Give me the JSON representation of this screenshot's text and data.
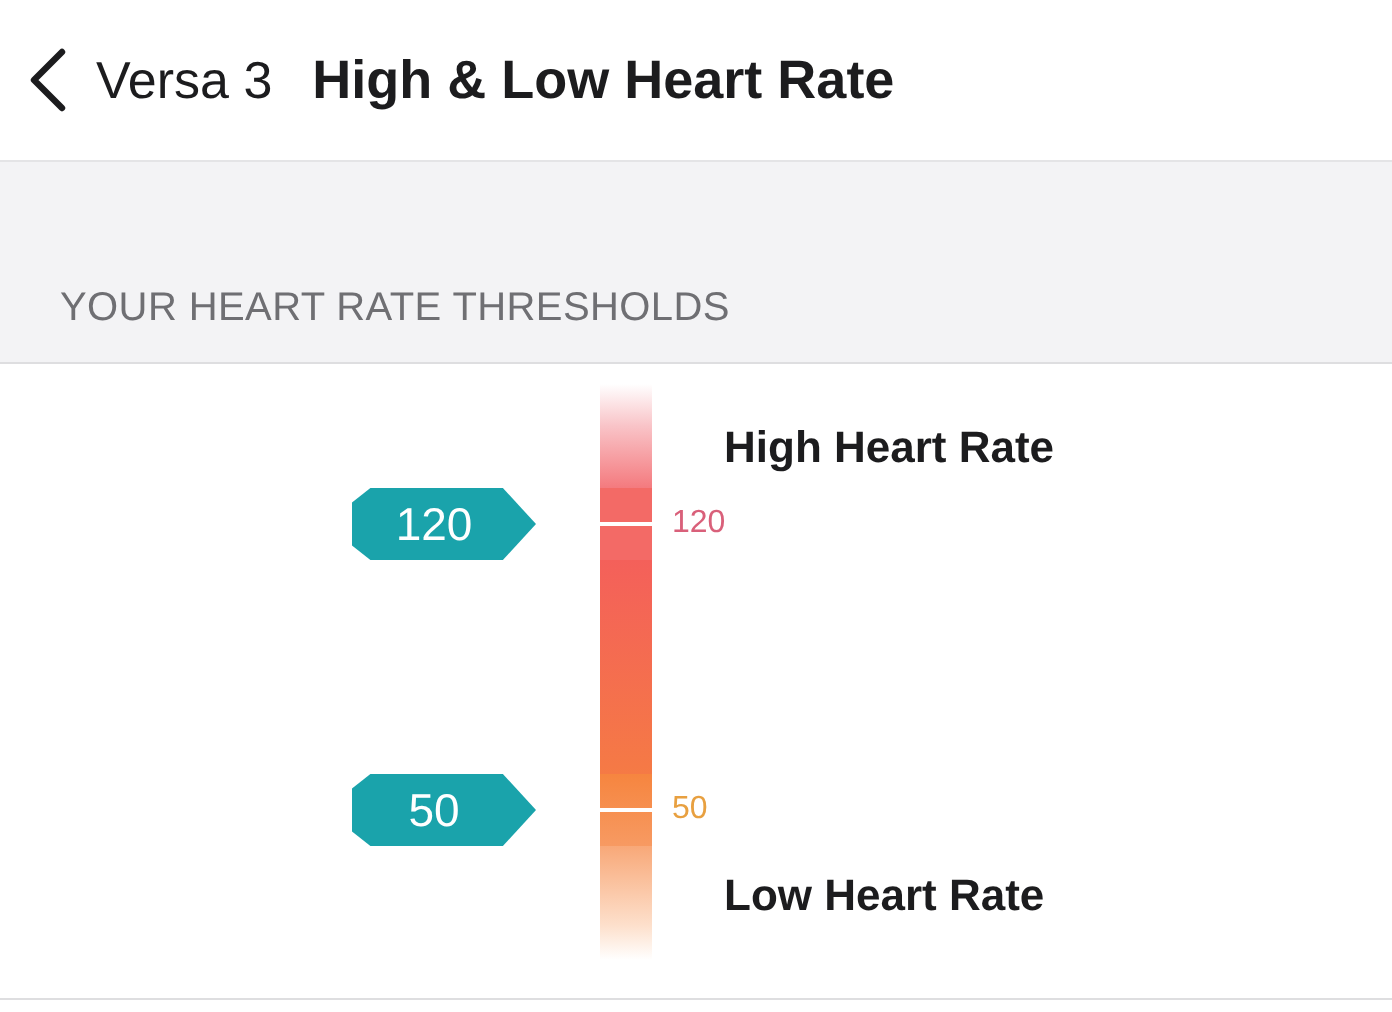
{
  "header": {
    "back_label": "Versa 3",
    "title": "High & Low Heart Rate"
  },
  "section": {
    "title": "YOUR HEART RATE THRESHOLDS"
  },
  "thresholds": [
    {
      "kind": "high",
      "marker": "120",
      "tick_label": "120",
      "label": "High Heart Rate"
    },
    {
      "kind": "low",
      "marker": "50",
      "tick_label": "50",
      "label": "Low Heart Rate"
    }
  ]
}
